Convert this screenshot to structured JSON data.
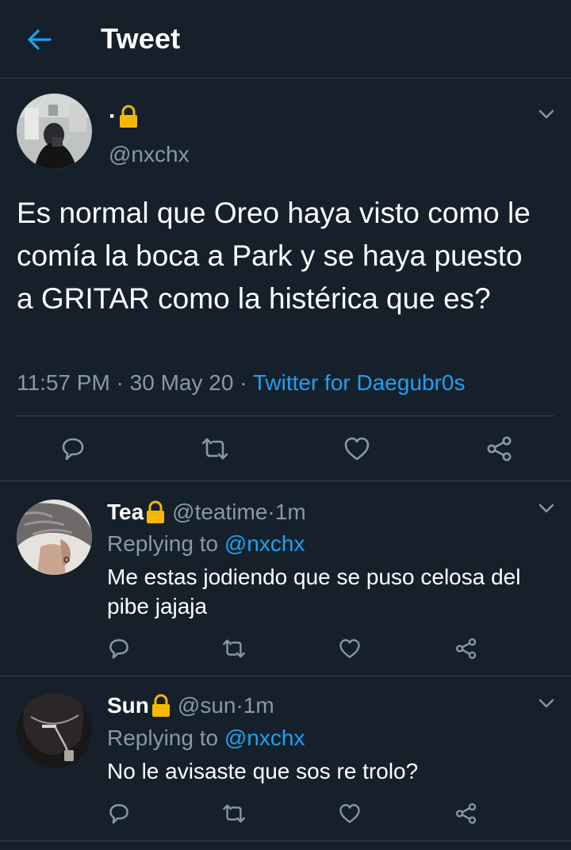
{
  "header": {
    "title": "Tweet",
    "back_icon": "arrow-left-icon",
    "accent": "#1da1f2"
  },
  "main_tweet": {
    "display_name": "·",
    "name_badge_icon": "lock-icon",
    "handle": "@nxchx",
    "text": "Es normal que Oreo haya visto como le comía la boca a Park y se haya puesto a GRITAR como la histérica que es?",
    "time": "11:57 PM",
    "separator": " · ",
    "date": "30 May 20",
    "separator2": " · ",
    "source": "Twitter for Daegubr0s",
    "actions": [
      "reply-icon",
      "retweet-icon",
      "like-icon",
      "share-icon"
    ]
  },
  "replies": [
    {
      "display_name": "Tea",
      "handle": "@teatime",
      "sep": " · ",
      "age": "1m",
      "replying_label": "Replying to ",
      "replying_to": "@nxchx",
      "text": "Me estas jodiendo que se puso celosa del pibe jajaja"
    },
    {
      "display_name": "Sun",
      "handle": "@sun",
      "sep": " · ",
      "age": "1m",
      "replying_label": "Replying to ",
      "replying_to": "@nxchx",
      "text": "No le avisaste que sos re trolo?"
    }
  ],
  "colors": {
    "background": "#15202b",
    "divider": "#38444d",
    "secondary_text": "#8899a6",
    "link": "#1da1f2",
    "lock": "#f5b800"
  }
}
